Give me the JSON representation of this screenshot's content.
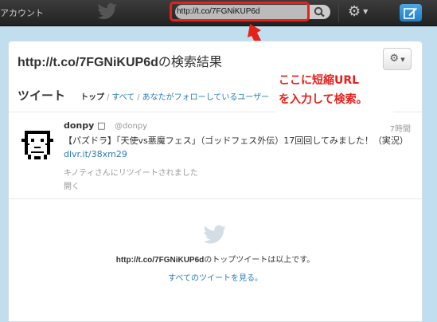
{
  "topbar": {
    "account_label": "アカウント",
    "search_value": "http://t.co/7FGNiKUP6d",
    "icons": {
      "bird": "twitter-bird-icon",
      "search": "search-icon",
      "gear": "gear-icon",
      "compose": "compose-icon"
    }
  },
  "page": {
    "title_url": "http://t.co/7FGNiKUP6d",
    "title_suffix": "の検索結果"
  },
  "tweets_section": {
    "heading": "ツイート",
    "filters": [
      "トップ",
      "すべて",
      "あなたがフォローしているユーザー"
    ],
    "active_filter": "トップ"
  },
  "tweet": {
    "name": "donpy",
    "badge": "□",
    "handle": "@donpy",
    "time": "7時間",
    "text": "【パズドラ】「天使vs悪魔フェス」（ゴッドフェス外伝）17回回してみました！（実況）",
    "link": "dlvr.it/38xm29",
    "retweet_note": "キノティさんにリツイートされました",
    "expand": "開く"
  },
  "end_of_results": {
    "url": "http://t.co/7FGNiKUP6d",
    "message": "のトップツイートは以上です。",
    "see_all": "すべてのツイートを見る。"
  },
  "annotation": {
    "line1": "ここに短縮URL",
    "line2": "を入力して検索。",
    "color": "#e8201a"
  },
  "colors": {
    "background": "#c0deed",
    "link": "#2b7bb9",
    "highlight": "#e8201a"
  }
}
